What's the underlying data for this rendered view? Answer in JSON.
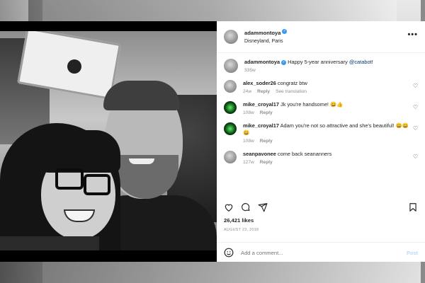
{
  "post": {
    "username": "adammontoya",
    "location": "Disneyland, Paris",
    "caption_user": "adammontoya",
    "caption_text": "Happy 5-year anniversary",
    "caption_mention": "@catabot",
    "caption_suffix": "!",
    "caption_age": "335w"
  },
  "comments": [
    {
      "user": "alex_soder26",
      "text": "congratz btw",
      "age": "24w",
      "reply": "Reply",
      "extra": "See translation"
    },
    {
      "user": "mike_croyal17",
      "text": "Jk you're handsome! 😀👍",
      "age": "108w",
      "reply": "Reply"
    },
    {
      "user": "mike_croyal17",
      "text": "Adam you're not so attractive and she's beautiful! 😄😄😄",
      "age": "108w",
      "reply": "Reply"
    },
    {
      "user": "seanpavonee",
      "text": "come back seananners",
      "age": "127w",
      "reply": "Reply"
    }
  ],
  "likes": "26,421 likes",
  "date": "AUGUST 23, 2018",
  "add_comment": {
    "placeholder": "Add a comment...",
    "post_label": "Post"
  },
  "icons": {
    "more": "more-options-icon",
    "heart": "heart-icon",
    "comment": "comment-icon",
    "share": "share-icon",
    "bookmark": "bookmark-icon",
    "emoji": "emoji-icon",
    "verified": "verified-badge-icon"
  },
  "colors": {
    "verified": "#3897f0",
    "link": "#00376b",
    "secondary": "#8e8e8e",
    "post_disabled": "#b3dbff"
  }
}
